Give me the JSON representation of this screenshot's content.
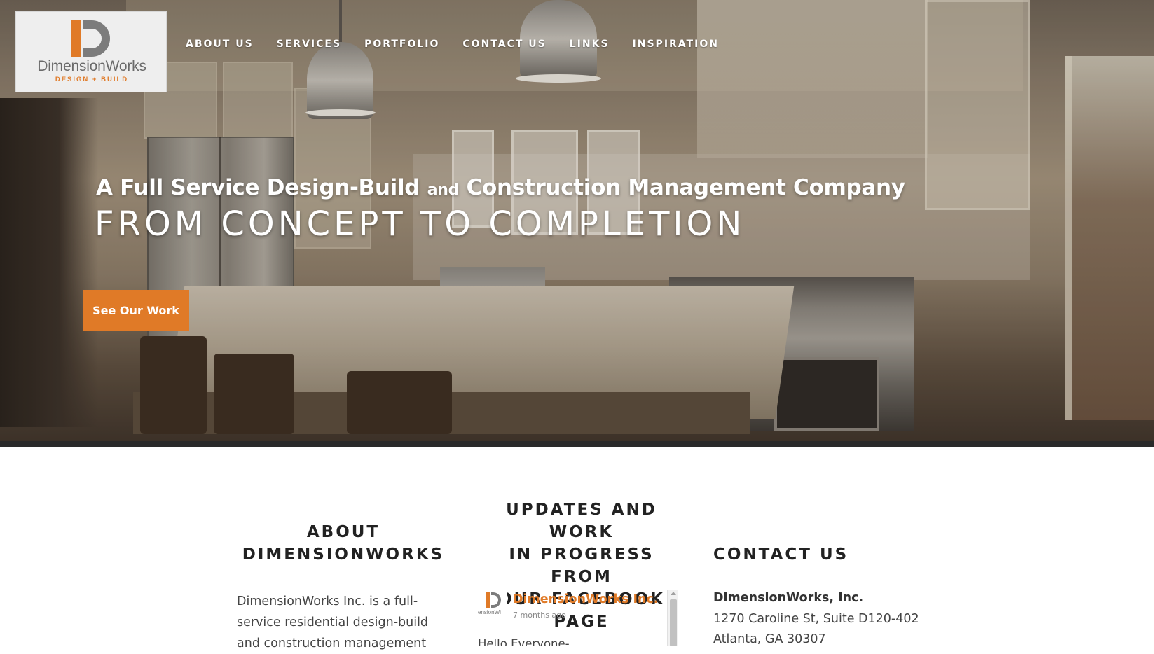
{
  "logo": {
    "name": "DimensionWorks",
    "tagline": "DESIGN + BUILD"
  },
  "nav": {
    "items": [
      {
        "label": "ABOUT US"
      },
      {
        "label": "SERVICES"
      },
      {
        "label": "PORTFOLIO"
      },
      {
        "label": "CONTACT US"
      },
      {
        "label": "LINKS"
      },
      {
        "label": "INSPIRATION"
      }
    ]
  },
  "hero": {
    "headline_part1": "A Full Service Design-Build ",
    "headline_and": "and",
    "headline_part2": " Construction Management Company",
    "subline": "FROM CONCEPT TO COMPLETION",
    "cta_label": "See Our Work",
    "accent_color": "#e07a27"
  },
  "about": {
    "heading_line1": "ABOUT",
    "heading_line2": "DIMENSIONWORKS",
    "text": "DimensionWorks Inc. is a full-service residential design-build and construction management"
  },
  "facebook": {
    "heading_line1": "UPDATES AND WORK",
    "heading_line2": "IN PROGRESS FROM",
    "heading_line3": "OUR FACEBOOK PAGE",
    "avatar_text": "ensionWi",
    "page_name": "DimensionWorks Inc.",
    "time": "7 months ago",
    "post_start": "Hello Everyone-"
  },
  "contact": {
    "heading": "CONTACT US",
    "company": "DimensionWorks, Inc.",
    "address_line1": "1270 Caroline St, Suite D120-402",
    "address_line2": "Atlanta, GA  30307"
  }
}
